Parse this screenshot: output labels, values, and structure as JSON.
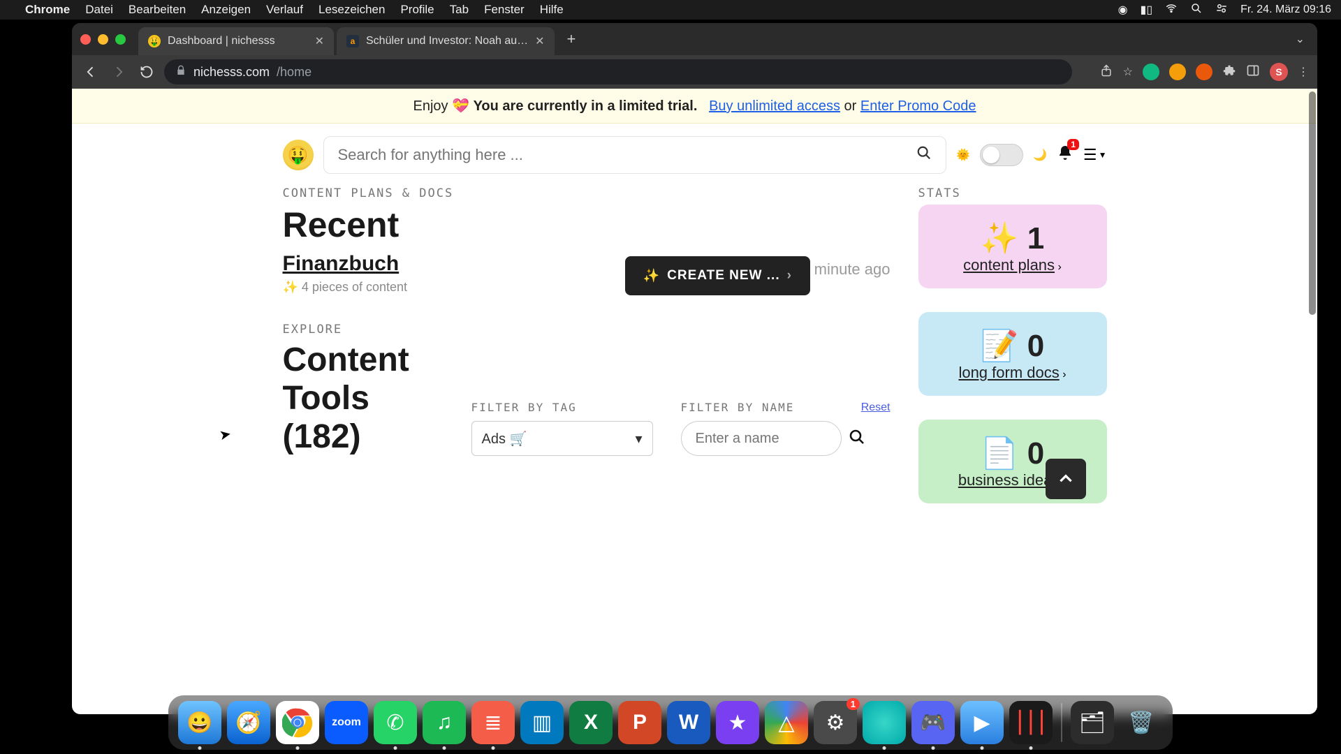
{
  "menubar": {
    "app": "Chrome",
    "items": [
      "Datei",
      "Bearbeiten",
      "Anzeigen",
      "Verlauf",
      "Lesezeichen",
      "Profile",
      "Tab",
      "Fenster",
      "Hilfe"
    ],
    "clock": "Fr. 24. März 09:16"
  },
  "browser": {
    "tabs": [
      {
        "title": "Dashboard | nichesss",
        "active": true
      },
      {
        "title": "Schüler und Investor: Noah au…",
        "active": false
      }
    ],
    "url_host": "nichesss.com",
    "url_path": "/home",
    "avatar_initial": "S"
  },
  "trialbar": {
    "prefix": "Enjoy ",
    "strong": "You are currently in a limited trial.",
    "buy": "Buy unlimited access",
    "or": " or ",
    "promo": "Enter Promo Code"
  },
  "topbar": {
    "search_placeholder": "Search for anything here ...",
    "bell_badge": "1"
  },
  "content": {
    "eyebrow": "CONTENT PLANS & DOCS",
    "heading": "Recent",
    "create_label": "CREATE NEW ...",
    "item_title": "Finanzbuch",
    "item_sub": "✨ 4 pieces of content",
    "item_time": "about a minute ago"
  },
  "stats": {
    "eyebrow": "STATS",
    "cards": [
      {
        "emoji": "✨",
        "value": "1",
        "label": "content plans"
      },
      {
        "emoji": "📝",
        "value": "0",
        "label": "long form docs"
      },
      {
        "emoji": "📄",
        "value": "0",
        "label": "business ideas"
      }
    ]
  },
  "explore": {
    "eyebrow": "EXPLORE",
    "heading": "Content Tools (182)",
    "filter_tag_label": "FILTER BY TAG",
    "filter_tag_value": "Ads 🛒",
    "filter_name_label": "FILTER BY NAME",
    "filter_name_placeholder": "Enter a name",
    "reset": "Reset"
  },
  "dock": {
    "settings_badge": "1"
  }
}
